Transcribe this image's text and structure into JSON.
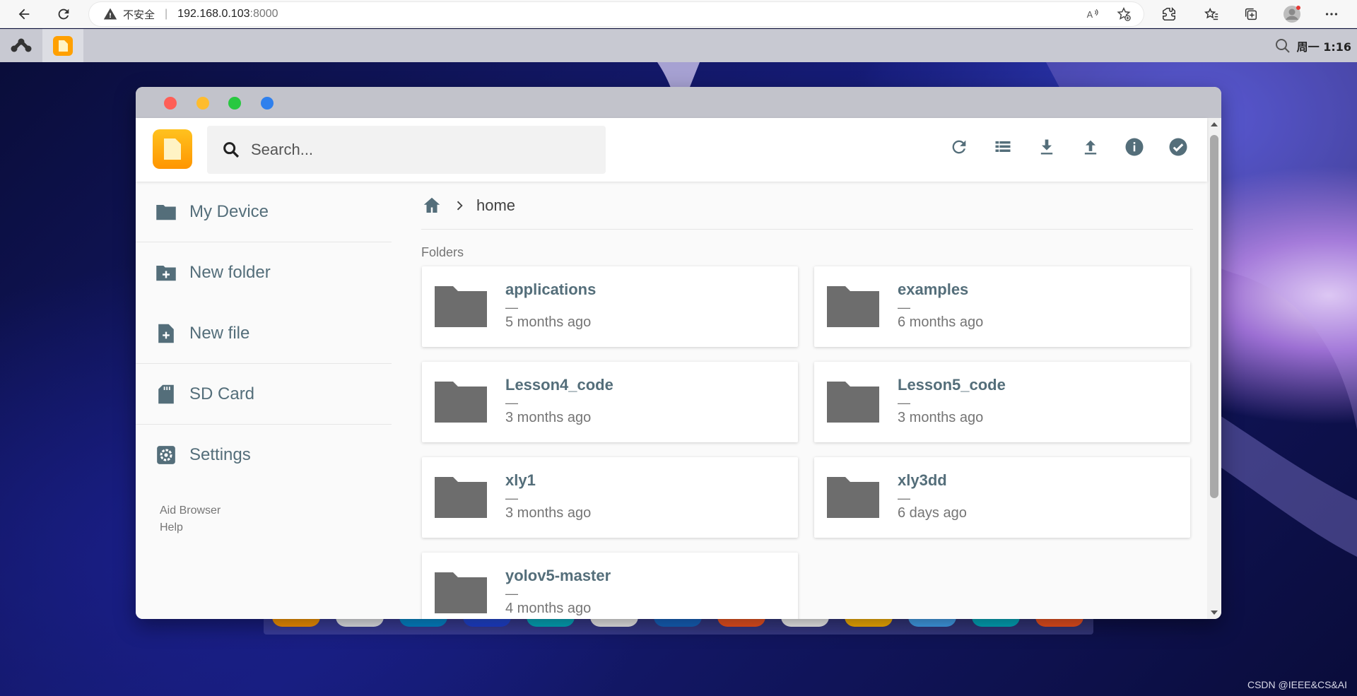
{
  "browser": {
    "security_label": "不安全",
    "url_host": "192.168.0.103",
    "url_port": ":8000"
  },
  "os_bar": {
    "clock": "周一 1:16"
  },
  "app": {
    "search": {
      "placeholder": "Search..."
    },
    "toolbar": [
      "refresh-icon",
      "list-view-icon",
      "download-icon",
      "upload-icon",
      "info-icon",
      "check-circle-icon"
    ],
    "sidebar": {
      "items": [
        {
          "label": "My Device",
          "icon": "folder-icon"
        },
        {
          "label": "New folder",
          "icon": "new-folder-icon"
        },
        {
          "label": "New file",
          "icon": "new-file-icon"
        },
        {
          "label": "SD Card",
          "icon": "sd-card-icon"
        },
        {
          "label": "Settings",
          "icon": "settings-icon"
        }
      ],
      "footer": [
        "Aid Browser",
        "Help"
      ]
    },
    "breadcrumb": {
      "current": "home"
    },
    "section_title": "Folders",
    "folders": [
      {
        "name": "applications",
        "size": "—",
        "modified": "5 months ago"
      },
      {
        "name": "examples",
        "size": "—",
        "modified": "6 months ago"
      },
      {
        "name": "Lesson4_code",
        "size": "—",
        "modified": "3 months ago"
      },
      {
        "name": "Lesson5_code",
        "size": "—",
        "modified": "3 months ago"
      },
      {
        "name": "xly1",
        "size": "—",
        "modified": "3 months ago"
      },
      {
        "name": "xly3dd",
        "size": "—",
        "modified": "6 days ago"
      },
      {
        "name": "yolov5-master",
        "size": "—",
        "modified": "4 months ago"
      }
    ]
  },
  "dock": [
    "files",
    "terminal",
    "browser",
    "code-editor",
    "cloud",
    "settings",
    "app-store",
    "tips",
    "calculator",
    "touch",
    "tools",
    "mouse-app",
    "aid-logo"
  ],
  "watermark": "CSDN @IEEE&CS&AI",
  "colors": {
    "accent_orange": "#ff9800",
    "sidebar_text": "#546e7a",
    "folder_icon": "#6d6d6d"
  }
}
